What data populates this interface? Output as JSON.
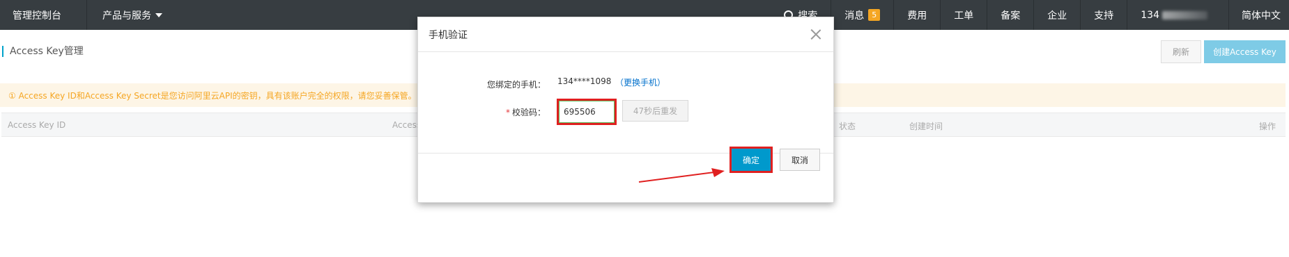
{
  "topbar": {
    "brand": "管理控制台",
    "products": "产品与服务",
    "search": "搜索",
    "messages": "消息",
    "messages_badge": "5",
    "fees": "费用",
    "tickets": "工单",
    "filing": "备案",
    "enterprise": "企业",
    "support": "支持",
    "account": "134",
    "language": "简体中文"
  },
  "page": {
    "title": "Access Key管理",
    "refresh_label": "刷新",
    "create_label": "创建Access Key",
    "warning": "① Access Key ID和Access Key Secret是您访问阿里云API的密钥，具有该账户完全的权限，请您妥善保管。",
    "table_headers": [
      "Access Key ID",
      "Access",
      "状态",
      "创建时间",
      "操作"
    ]
  },
  "modal": {
    "title": "手机验证",
    "phone_label": "您绑定的手机：",
    "phone_value": "134****1098",
    "change_phone": "更换手机",
    "paren_open": "（",
    "paren_close": "）",
    "required_mark": "*",
    "code_label": "校验码：",
    "code_value": "695506",
    "resend_label": "47秒后重发",
    "confirm_label": "确定",
    "cancel_label": "取消"
  },
  "colors": {
    "topbar": "#373d41",
    "accent": "#0099cc",
    "highlight": "#e02020",
    "warning": "#f5a623"
  }
}
